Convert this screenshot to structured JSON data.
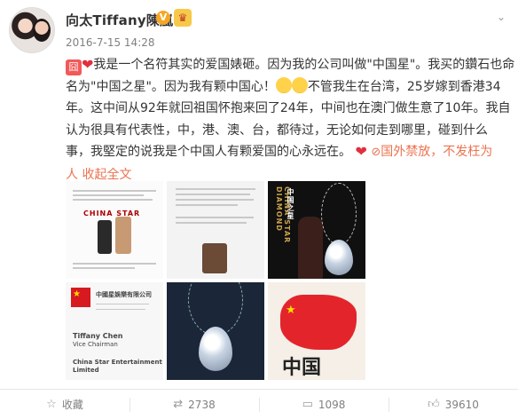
{
  "author": {
    "name": "向太Tiffany陳嵐",
    "verified_badge": "V",
    "timestamp": "2016-7-15 14:28"
  },
  "post": {
    "lines": [
      "我是一个名符其实的爱国婊砸。因为我的公司叫做\"中国星\"。我买的鑽石也命",
      "名为\"中国之星\"。因为我有颗中国心！",
      "不管我生在台湾，25岁嫁到香港34",
      "年。这中间从92年就回祖国怀抱来回了24年，中间也在澳门做生意了10年。我自",
      "认为很具有代表性，中，港、澳、台，都待过，无论如何走到哪里，碰到什么",
      "事，我堅定的说我是个中国人有颗爱国的心永远在。"
    ],
    "link_text_1": "国外禁放，不发枉为",
    "link_text_2": "人",
    "collapse_label": "收起全文"
  },
  "photos": {
    "p1_logo": "CHINA STAR",
    "p3_vertical": "CHINA STAR DIAMOND",
    "p3_vertical_cn": "中国之星",
    "p4_company": "中國星娛樂有限公司",
    "p4_name": "Tiffany Chen",
    "p4_title": "Vice Chairman",
    "p4_footer": "China Star Entertainment Limited",
    "p6_text": "中国"
  },
  "actions": {
    "favorite_label": "收藏",
    "repost_count": "2738",
    "comment_count": "1098",
    "like_count": "39610"
  }
}
